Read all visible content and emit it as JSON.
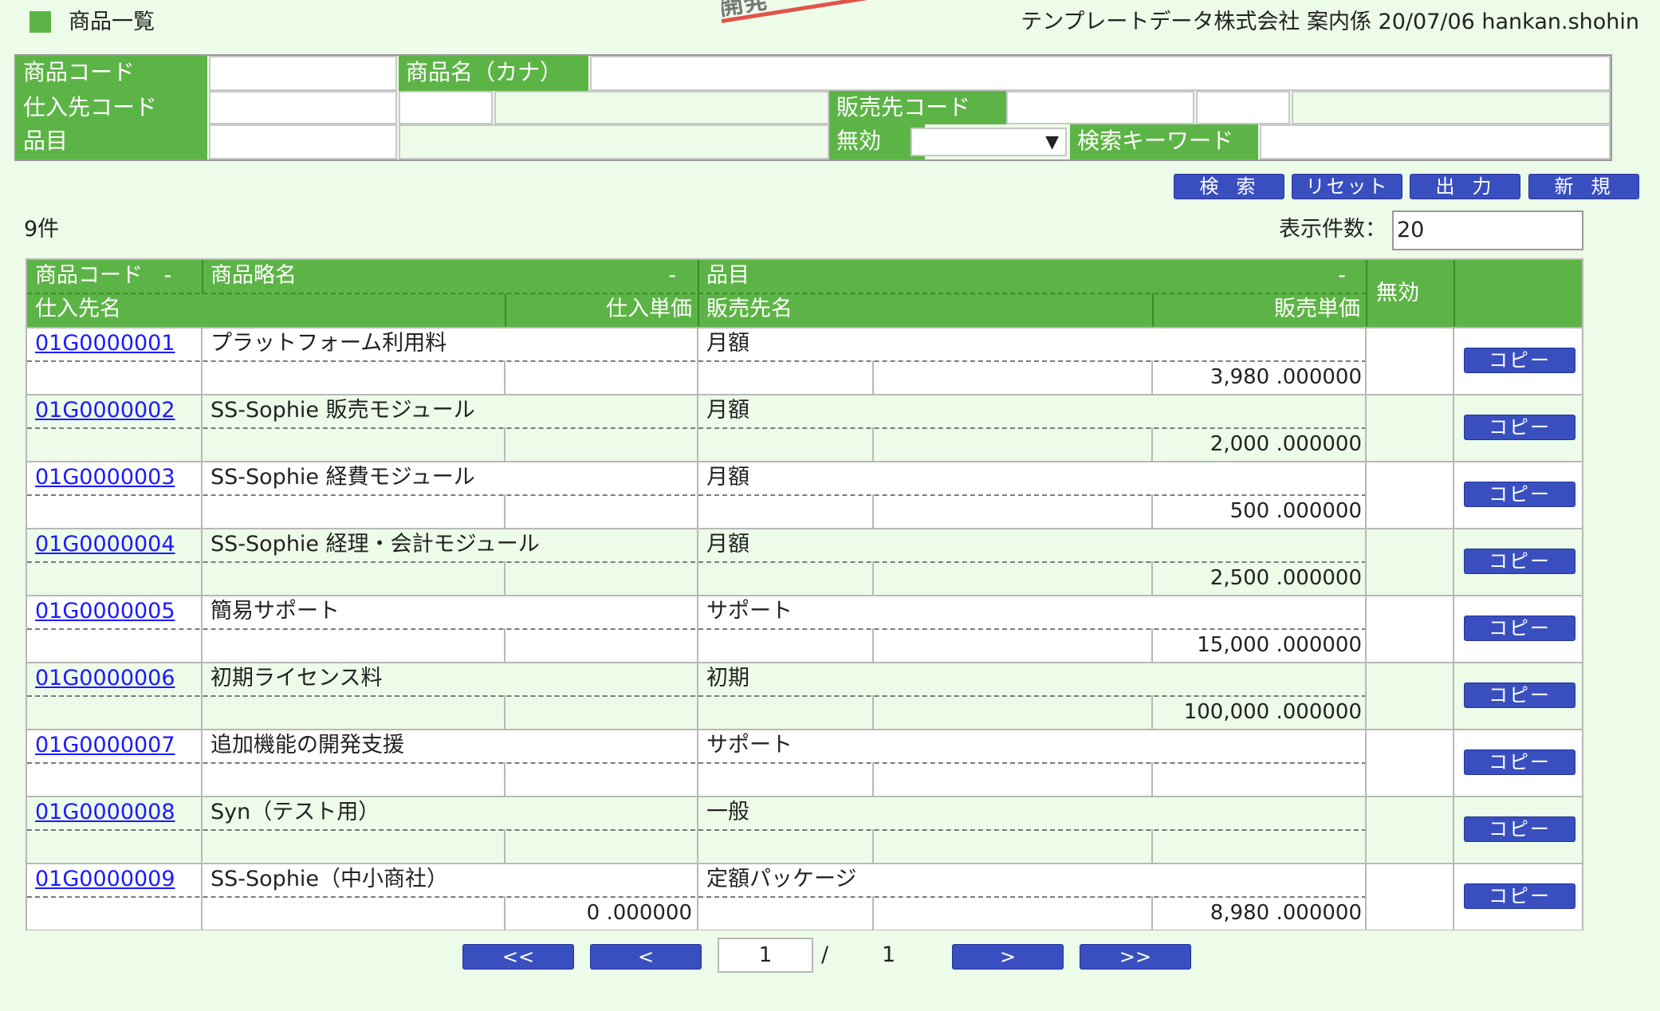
{
  "header": {
    "title": "商品一覧",
    "info": "テンプレートデータ株式会社 案内係 20/07/06 hankan.shohin",
    "stamp": "開発"
  },
  "search": {
    "product_code_label": "商品コード",
    "product_name_label": "商品名（カナ）",
    "supplier_code_label": "仕入先コード",
    "customer_code_label": "販売先コード",
    "item_label": "品目",
    "invalid_label": "無効",
    "keyword_label": "検索キーワード"
  },
  "buttons": {
    "search": "検索",
    "reset": "リセット",
    "export": "出力",
    "new": "新規"
  },
  "results": {
    "count": "9件",
    "per_page_label": "表示件数：",
    "per_page_value": "20"
  },
  "table": {
    "headers": {
      "code": "商品コード",
      "short_name": "商品略名",
      "item": "品目",
      "invalid": "無効",
      "supplier": "仕入先名",
      "purchase_price": "仕入単価",
      "customer": "販売先名",
      "sale_price": "販売単価",
      "sort_mark": "-"
    },
    "copy_label": "コピー",
    "rows": [
      {
        "code": "01G0000001",
        "name": "プラットフォーム利用料",
        "item": "月額",
        "purchase_price": "",
        "sale_price": "3,980 .000000"
      },
      {
        "code": "01G0000002",
        "name": "SS-Sophie 販売モジュール",
        "item": "月額",
        "purchase_price": "",
        "sale_price": "2,000 .000000"
      },
      {
        "code": "01G0000003",
        "name": "SS-Sophie 経費モジュール",
        "item": "月額",
        "purchase_price": "",
        "sale_price": "500 .000000"
      },
      {
        "code": "01G0000004",
        "name": "SS-Sophie 経理・会計モジュール",
        "item": "月額",
        "purchase_price": "",
        "sale_price": "2,500 .000000"
      },
      {
        "code": "01G0000005",
        "name": "簡易サポート",
        "item": "サポート",
        "purchase_price": "",
        "sale_price": "15,000 .000000"
      },
      {
        "code": "01G0000006",
        "name": "初期ライセンス料",
        "item": "初期",
        "purchase_price": "",
        "sale_price": "100,000 .000000"
      },
      {
        "code": "01G0000007",
        "name": "追加機能の開発支援",
        "item": "サポート",
        "purchase_price": "",
        "sale_price": ""
      },
      {
        "code": "01G0000008",
        "name": "Syn（テスト用）",
        "item": "一般",
        "purchase_price": "",
        "sale_price": ""
      },
      {
        "code": "01G0000009",
        "name": "SS-Sophie（中小商社）",
        "item": "定額パッケージ",
        "purchase_price": "0 .000000",
        "sale_price": "8,980 .000000"
      }
    ]
  },
  "pager": {
    "first": "<<",
    "prev": "<",
    "next": ">",
    "last": ">>",
    "current": "1",
    "separator": "/",
    "total": "1"
  }
}
